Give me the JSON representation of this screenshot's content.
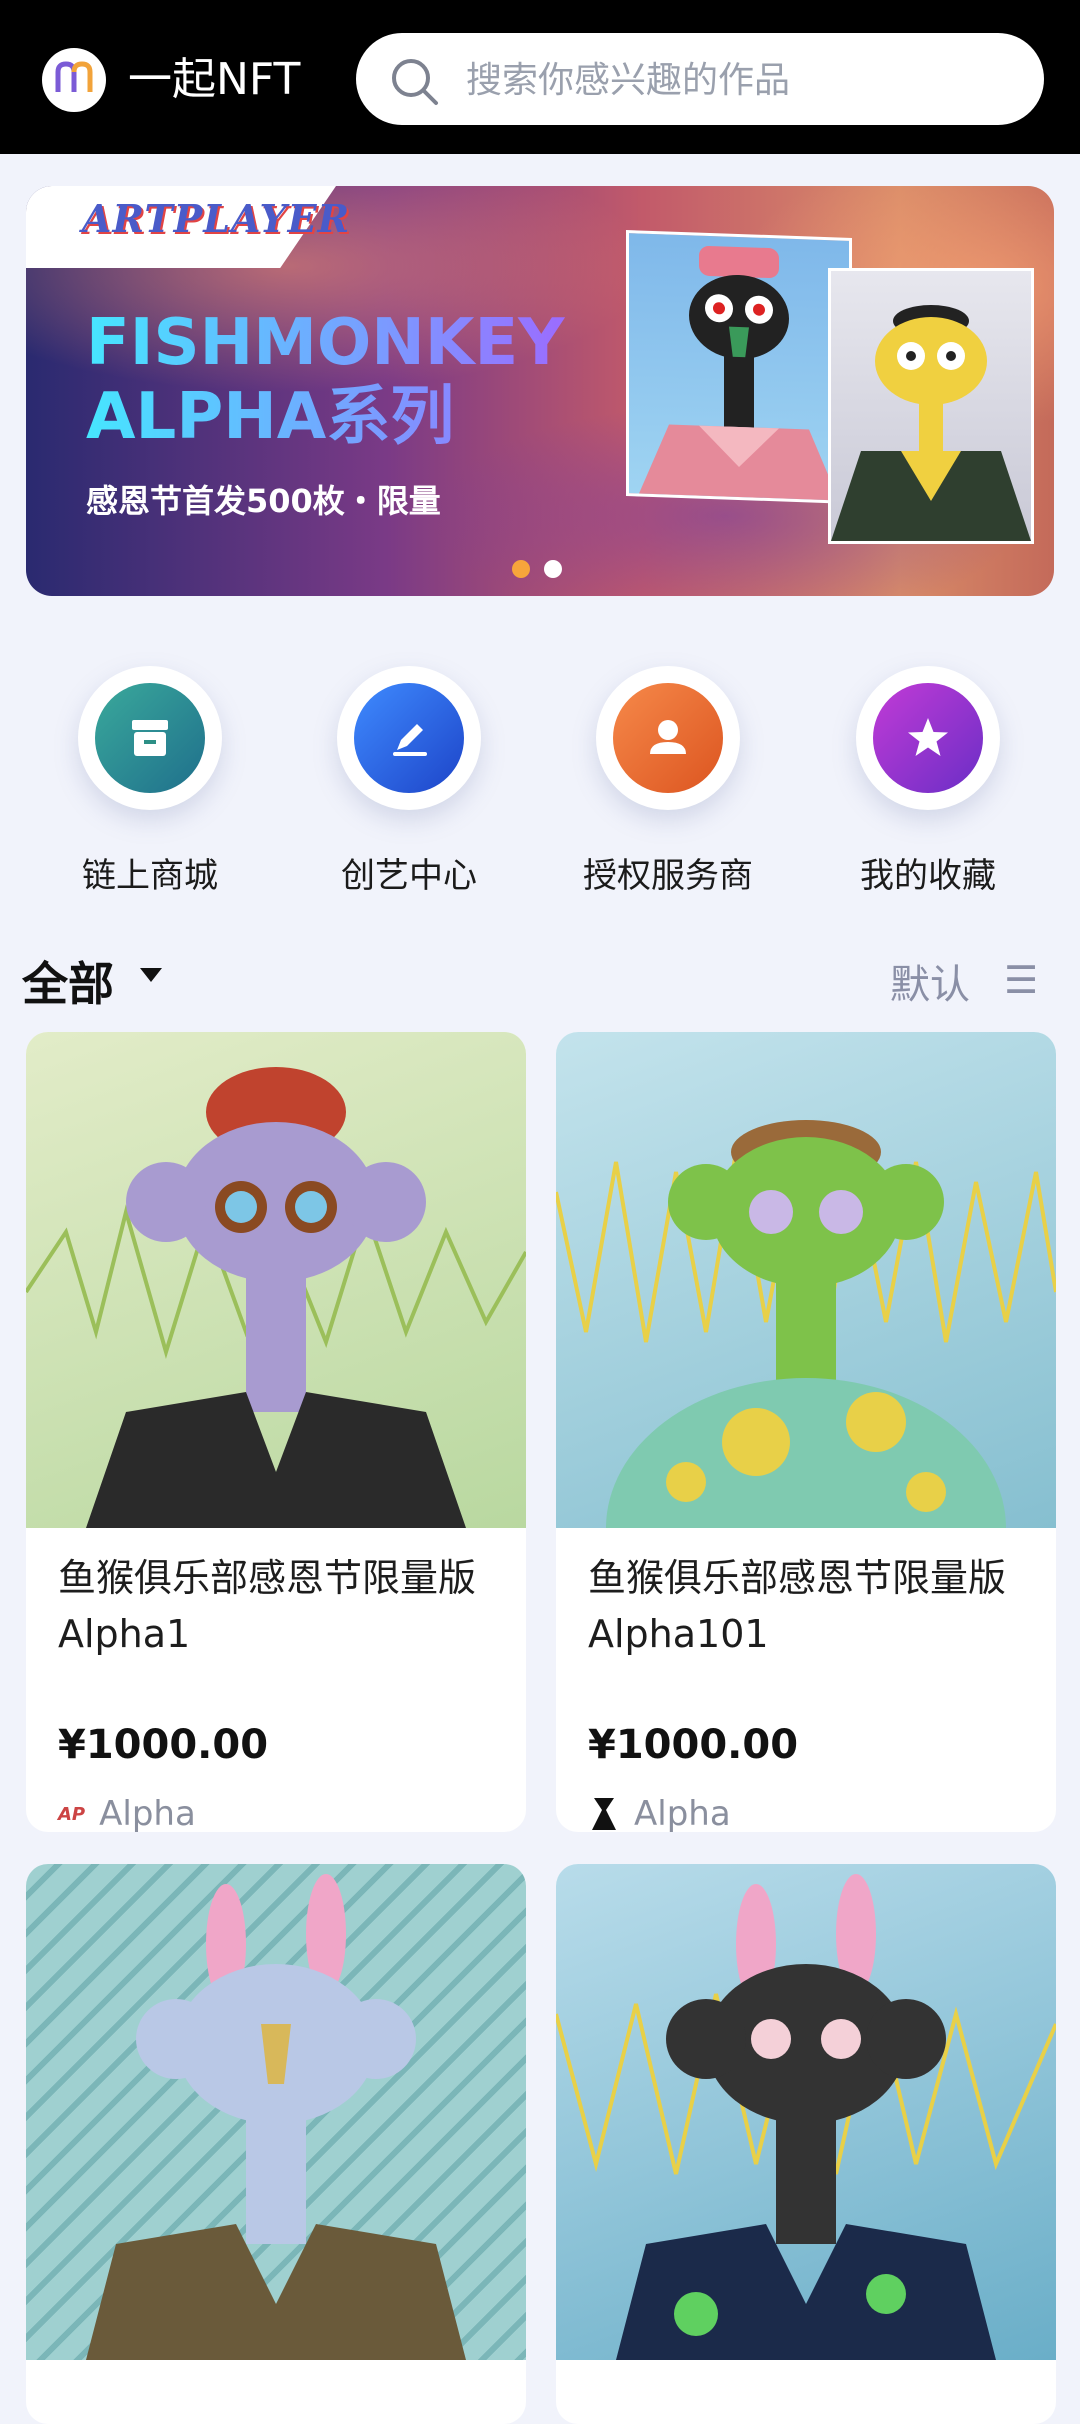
{
  "header": {
    "app_title": "一起NFT",
    "search_placeholder": "搜索你感兴趣的作品"
  },
  "banner": {
    "brand": "ARTPLAYER",
    "title_line1": "FISHMONKEY",
    "title_line2": "ALPHA系列",
    "subtitle": "感恩节首发500枚・限量",
    "active_index": 0,
    "total": 2
  },
  "quick_nav": [
    {
      "label": "链上商城",
      "icon": "store-icon",
      "color": "#2c8f86"
    },
    {
      "label": "创艺中心",
      "icon": "pen-icon",
      "color": "#2563e8"
    },
    {
      "label": "授权服务商",
      "icon": "user-icon",
      "color": "#e86a2c"
    },
    {
      "label": "我的收藏",
      "icon": "star-icon",
      "color": "#8b35c9"
    }
  ],
  "filter": {
    "category": "全部",
    "sort": "默认"
  },
  "products": [
    {
      "name": "鱼猴俱乐部感恩节限量版Alpha1",
      "price": "¥1000.00",
      "creator": "Alpha",
      "bg": "#cfe3b4"
    },
    {
      "name": "鱼猴俱乐部感恩节限量版Alpha101",
      "price": "¥1000.00",
      "creator": "Alpha",
      "bg": "#9fd0df"
    },
    {
      "name": "",
      "price": "",
      "creator": "",
      "bg": "#a9d6d6"
    },
    {
      "name": "",
      "price": "",
      "creator": "",
      "bg": "#86c5dc"
    }
  ]
}
